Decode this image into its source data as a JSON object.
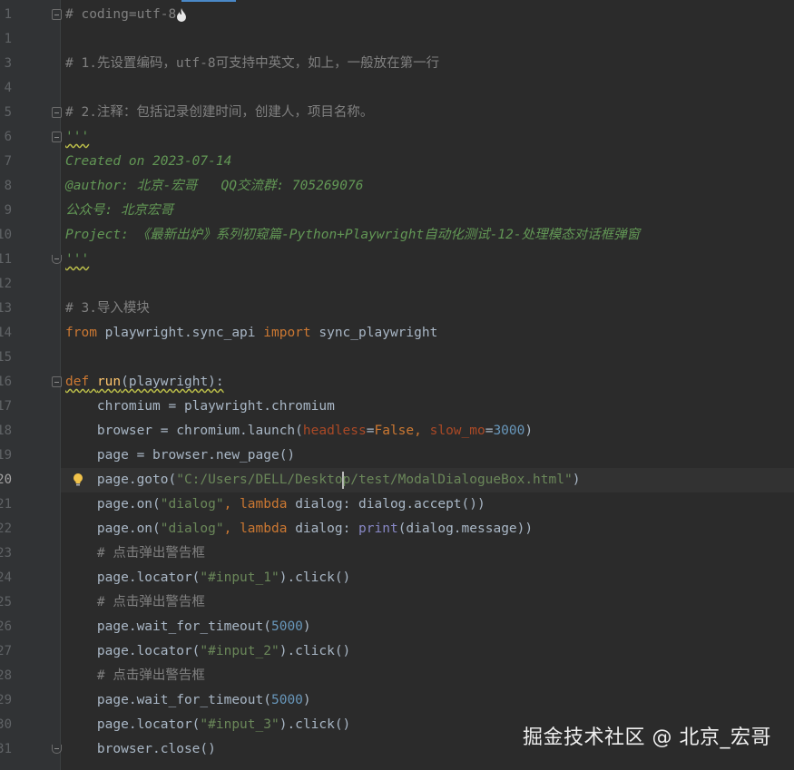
{
  "colors": {
    "background": "#2b2b2b",
    "gutter": "#313335",
    "line_number": "#606366",
    "comment": "#808080",
    "docstring": "#629755",
    "keyword": "#cc7832",
    "string": "#6a8759",
    "number": "#6897bb",
    "parameter": "#aa4926",
    "builtin": "#8888c6",
    "text": "#a9b7c6"
  },
  "editor": {
    "current_line": 20,
    "lines": [
      {
        "n": "1",
        "segs": [
          {
            "t": "# coding=utf-8",
            "c": "comment"
          }
        ],
        "fold": "start",
        "flame": true
      },
      {
        "n": "1",
        "segs": []
      },
      {
        "n": "3",
        "segs": [
          {
            "t": "# 1.先设置编码，utf-8可支持中英文，如上，一般放在第一行",
            "c": "comment"
          }
        ]
      },
      {
        "n": "4",
        "segs": []
      },
      {
        "n": "5",
        "segs": [
          {
            "t": "# 2.注释：包括记录创建时间，创建人，项目名称。",
            "c": "comment"
          }
        ],
        "fold": "start"
      },
      {
        "n": "6",
        "segs": [
          {
            "t": "'''",
            "c": "doc",
            "squiggle": true
          }
        ],
        "fold": "start"
      },
      {
        "n": "7",
        "segs": [
          {
            "t": "Created on 2023-07-14",
            "c": "doc"
          }
        ]
      },
      {
        "n": "8",
        "segs": [
          {
            "t": "@author: 北京-宏哥   QQ交流群: 705269076",
            "c": "doc"
          }
        ]
      },
      {
        "n": "9",
        "segs": [
          {
            "t": "公众号: 北京宏哥",
            "c": "doc"
          }
        ]
      },
      {
        "n": "10",
        "segs": [
          {
            "t": "Project: 《最新出炉》系列初窥篇-Python+Playwright自动化测试-12-处理模态对话框弹窗",
            "c": "doc"
          }
        ]
      },
      {
        "n": "11",
        "segs": [
          {
            "t": "'''",
            "c": "doc",
            "squiggle": true
          }
        ],
        "fold": "end"
      },
      {
        "n": "12",
        "segs": []
      },
      {
        "n": "13",
        "segs": [
          {
            "t": "# 3.导入模块",
            "c": "comment"
          }
        ]
      },
      {
        "n": "14",
        "segs": [
          {
            "t": "from",
            "c": "kw"
          },
          {
            "t": " playwright.sync_api ",
            "c": "text"
          },
          {
            "t": "import",
            "c": "kw"
          },
          {
            "t": " sync_playwright",
            "c": "text"
          }
        ]
      },
      {
        "n": "15",
        "segs": []
      },
      {
        "n": "16",
        "segs": [
          {
            "t": "def",
            "c": "kw",
            "squiggle": true
          },
          {
            "t": " ",
            "c": "text",
            "squiggle": true
          },
          {
            "t": "run",
            "c": "fn",
            "squiggle": true
          },
          {
            "t": "(playwright):",
            "c": "text",
            "squiggle": true
          }
        ],
        "fold": "start"
      },
      {
        "n": "17",
        "segs": [
          {
            "t": "    chromium = playwright.chromium",
            "c": "text"
          }
        ]
      },
      {
        "n": "18",
        "segs": [
          {
            "t": "    browser = chromium.launch(",
            "c": "text"
          },
          {
            "t": "headless",
            "c": "param"
          },
          {
            "t": "=",
            "c": "text"
          },
          {
            "t": "False",
            "c": "kw"
          },
          {
            "t": ", ",
            "c": "kw"
          },
          {
            "t": "slow_mo",
            "c": "param"
          },
          {
            "t": "=",
            "c": "text"
          },
          {
            "t": "3000",
            "c": "num"
          },
          {
            "t": ")",
            "c": "text"
          }
        ]
      },
      {
        "n": "19",
        "segs": [
          {
            "t": "    page = browser.new_page()",
            "c": "text"
          }
        ]
      },
      {
        "n": "20",
        "segs": [
          {
            "t": "    page.goto(",
            "c": "text"
          },
          {
            "t": "\"C:/Users/DELL/Deskto",
            "c": "str"
          },
          {
            "cursor": true
          },
          {
            "t": "p/test/ModalDialogueBox.html\"",
            "c": "str"
          },
          {
            "t": ")",
            "c": "text"
          }
        ],
        "bulb": true
      },
      {
        "n": "21",
        "segs": [
          {
            "t": "    page.on(",
            "c": "text"
          },
          {
            "t": "\"dialog\"",
            "c": "str"
          },
          {
            "t": ", ",
            "c": "kw"
          },
          {
            "t": "lambda",
            "c": "kw"
          },
          {
            "t": " dialog: dialog.accept())",
            "c": "text"
          }
        ]
      },
      {
        "n": "22",
        "segs": [
          {
            "t": "    page.on(",
            "c": "text"
          },
          {
            "t": "\"dialog\"",
            "c": "str"
          },
          {
            "t": ", ",
            "c": "kw"
          },
          {
            "t": "lambda",
            "c": "kw"
          },
          {
            "t": " dialog: ",
            "c": "text"
          },
          {
            "t": "print",
            "c": "builtin"
          },
          {
            "t": "(dialog.message))",
            "c": "text"
          }
        ]
      },
      {
        "n": "23",
        "segs": [
          {
            "t": "    # 点击弹出警告框",
            "c": "comment"
          }
        ]
      },
      {
        "n": "24",
        "segs": [
          {
            "t": "    page.locator(",
            "c": "text"
          },
          {
            "t": "\"#input_1\"",
            "c": "str"
          },
          {
            "t": ").click()",
            "c": "text"
          }
        ]
      },
      {
        "n": "25",
        "segs": [
          {
            "t": "    # 点击弹出警告框",
            "c": "comment"
          }
        ]
      },
      {
        "n": "26",
        "segs": [
          {
            "t": "    page.wait_for_timeout(",
            "c": "text"
          },
          {
            "t": "5000",
            "c": "num"
          },
          {
            "t": ")",
            "c": "text"
          }
        ]
      },
      {
        "n": "27",
        "segs": [
          {
            "t": "    page.locator(",
            "c": "text"
          },
          {
            "t": "\"#input_2\"",
            "c": "str"
          },
          {
            "t": ").click()",
            "c": "text"
          }
        ]
      },
      {
        "n": "28",
        "segs": [
          {
            "t": "    # 点击弹出警告框",
            "c": "comment"
          }
        ]
      },
      {
        "n": "29",
        "segs": [
          {
            "t": "    page.wait_for_timeout(",
            "c": "text"
          },
          {
            "t": "5000",
            "c": "num"
          },
          {
            "t": ")",
            "c": "text"
          }
        ]
      },
      {
        "n": "30",
        "segs": [
          {
            "t": "    page.locator(",
            "c": "text"
          },
          {
            "t": "\"#input_3\"",
            "c": "str"
          },
          {
            "t": ").click()",
            "c": "text"
          }
        ]
      },
      {
        "n": "31",
        "segs": [
          {
            "t": "    browser.close()",
            "c": "text"
          }
        ],
        "fold": "end"
      }
    ]
  },
  "watermark": {
    "text": "掘金技术社区 @ 北京_宏哥"
  }
}
